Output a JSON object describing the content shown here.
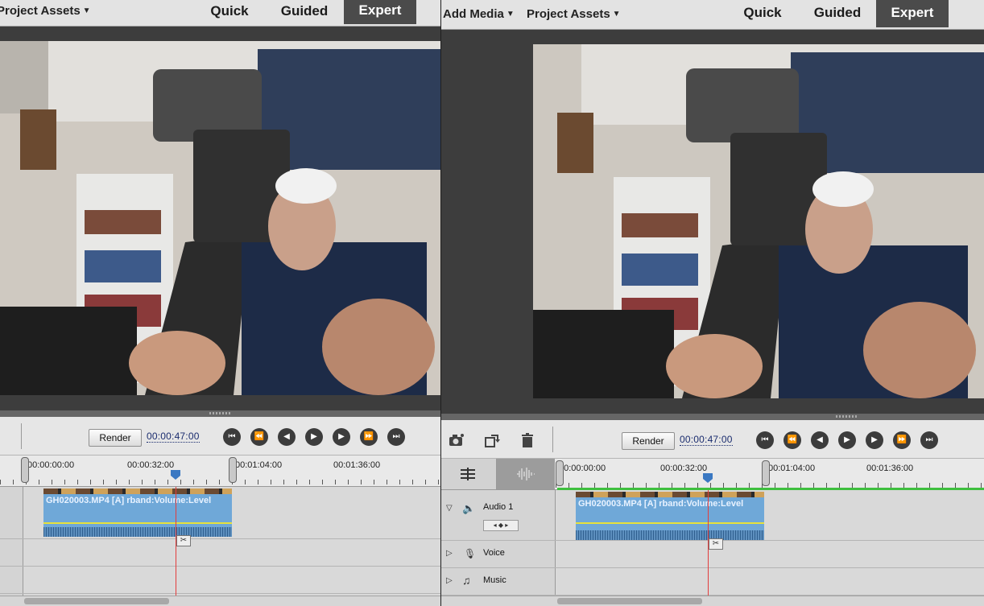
{
  "left": {
    "topbar": {
      "project_assets": "Project Assets",
      "modes": {
        "quick": "Quick",
        "guided": "Guided",
        "expert": "Expert"
      },
      "active_mode": "Expert"
    },
    "controls": {
      "render_label": "Render",
      "timecode": "00:00:47:00"
    },
    "ruler": {
      "labels": [
        "00:00:00:00",
        "00:00:32:00",
        "00:01:04:00",
        "00:01:36:00"
      ]
    },
    "clip": {
      "title": "GH020003.MP4 [A] rband:Volume:Level"
    }
  },
  "right": {
    "topbar": {
      "add_media": "Add Media",
      "project_assets": "Project Assets",
      "modes": {
        "quick": "Quick",
        "guided": "Guided",
        "expert": "Expert"
      },
      "active_mode": "Expert"
    },
    "controls": {
      "render_label": "Render",
      "timecode": "00:00:47:00"
    },
    "ruler": {
      "labels": [
        "00:00:00:00",
        "00:00:32:00",
        "00:01:04:00",
        "00:01:36:00"
      ]
    },
    "tracks": {
      "audio1": "Audio 1",
      "voice": "Voice",
      "music": "Music"
    },
    "clip": {
      "title": "GH020003.MP4 [A] rband:Volume:Level"
    }
  },
  "transport_icons": [
    "go-to-start-icon",
    "step-back-icon",
    "frame-back-icon",
    "play-icon",
    "frame-forward-icon",
    "step-forward-icon",
    "go-to-end-icon"
  ],
  "tool_icons": [
    "camera-effects-icon",
    "rotate-icon",
    "trash-icon"
  ],
  "colors": {
    "accent_dark": "#4b4b4b",
    "playhead": "#e23d3d",
    "clip": "#6fa8d8",
    "volume_line": "#e8e23a"
  }
}
